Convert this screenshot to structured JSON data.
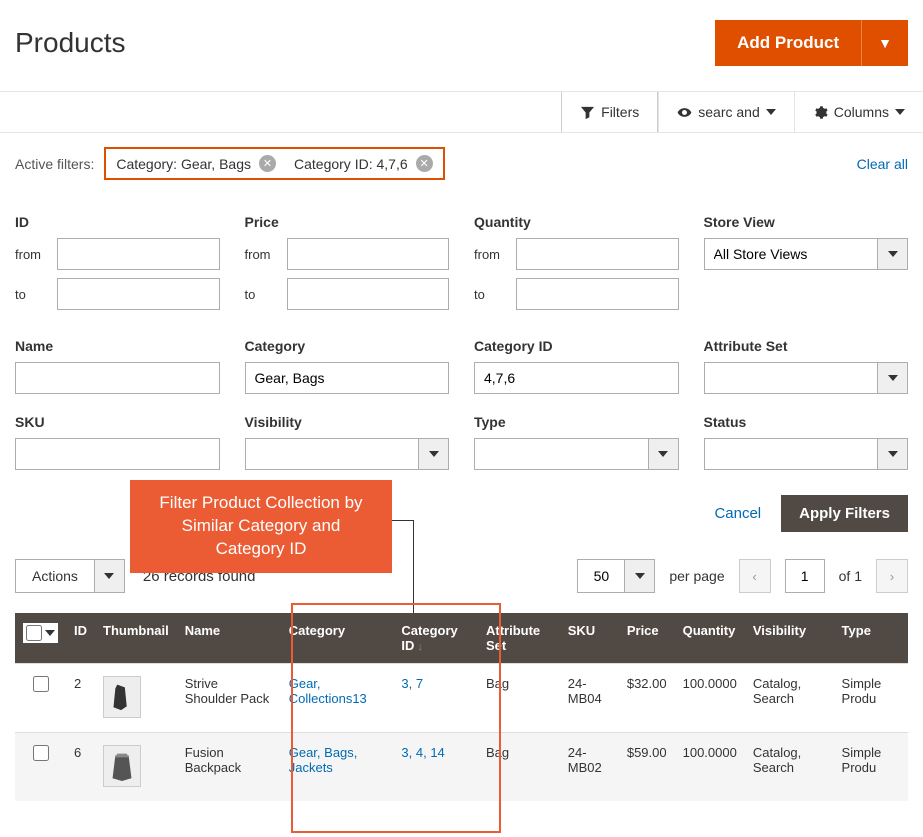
{
  "header": {
    "title": "Products",
    "addButton": "Add Product"
  },
  "toolbar": {
    "filters": "Filters",
    "search": "searc and",
    "columns": "Columns"
  },
  "activeFilters": {
    "label": "Active filters:",
    "chips": [
      {
        "text": "Category: Gear, Bags"
      },
      {
        "text": "Category ID: 4,7,6"
      }
    ],
    "clearAll": "Clear all"
  },
  "filterFields": {
    "id": {
      "label": "ID",
      "from": "from",
      "to": "to",
      "fromVal": "",
      "toVal": ""
    },
    "price": {
      "label": "Price",
      "from": "from",
      "to": "to",
      "fromVal": "",
      "toVal": ""
    },
    "quantity": {
      "label": "Quantity",
      "from": "from",
      "to": "to",
      "fromVal": "",
      "toVal": ""
    },
    "storeView": {
      "label": "Store View",
      "value": "All Store Views"
    },
    "name": {
      "label": "Name",
      "value": ""
    },
    "category": {
      "label": "Category",
      "value": "Gear, Bags"
    },
    "categoryId": {
      "label": "Category ID",
      "value": "4,7,6"
    },
    "attributeSet": {
      "label": "Attribute Set",
      "value": ""
    },
    "sku": {
      "label": "SKU",
      "value": ""
    },
    "visibility": {
      "label": "Visibility",
      "value": ""
    },
    "type": {
      "label": "Type",
      "value": ""
    },
    "status": {
      "label": "Status",
      "value": ""
    }
  },
  "filterActions": {
    "cancel": "Cancel",
    "apply": "Apply Filters"
  },
  "callout": {
    "line1": "Filter Product Collection by",
    "line2": "Similar Category and",
    "line3": "Category ID"
  },
  "gridControls": {
    "actions": "Actions",
    "recordsFound": "26 records found",
    "pageSize": "50",
    "perPage": "per page",
    "currentPage": "1",
    "ofText": "of 1"
  },
  "columns": {
    "id": "ID",
    "thumbnail": "Thumbnail",
    "name": "Name",
    "category": "Category",
    "categoryId": "Category ID",
    "attributeSet": "Attribute Set",
    "sku": "SKU",
    "price": "Price",
    "quantity": "Quantity",
    "visibility": "Visibility",
    "type": "Type"
  },
  "rows": [
    {
      "id": "2",
      "name": "Strive Shoulder Pack",
      "category": "Gear, Collections13",
      "categoryId": "3, 7",
      "attributeSet": "Bag",
      "sku": "24-MB04",
      "price": "$32.00",
      "quantity": "100.0000",
      "visibility": "Catalog, Search",
      "type": "Simple Produ"
    },
    {
      "id": "6",
      "name": "Fusion Backpack",
      "category": "Gear, Bags, Jackets",
      "categoryId": "3, 4, 14",
      "attributeSet": "Bag",
      "sku": "24-MB02",
      "price": "$59.00",
      "quantity": "100.0000",
      "visibility": "Catalog, Search",
      "type": "Simple Produ"
    }
  ]
}
